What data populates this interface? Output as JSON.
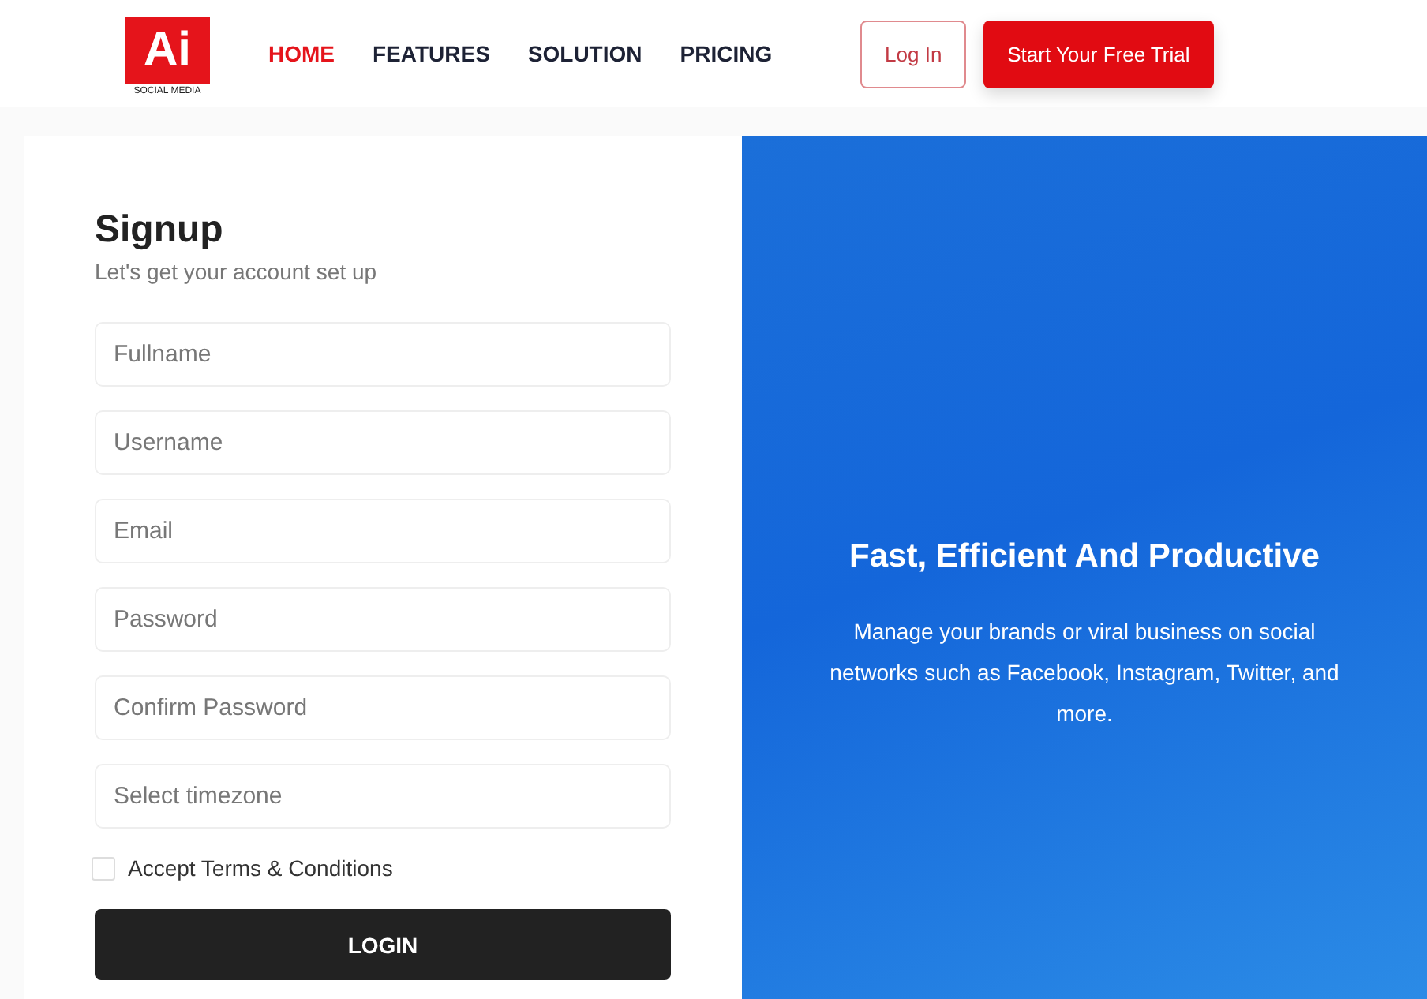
{
  "logo": {
    "mark": "Ai",
    "caption": "SOCIAL MEDIA"
  },
  "nav": [
    {
      "label": "HOME",
      "selected": true
    },
    {
      "label": "FEATURES",
      "selected": false
    },
    {
      "label": "SOLUTION",
      "selected": false
    },
    {
      "label": "PRICING",
      "selected": false
    }
  ],
  "header_buttons": {
    "login": "Log In",
    "trial": "Start Your Free Trial"
  },
  "signup": {
    "title": "Signup",
    "subtitle": "Let's get your account set up",
    "fields": [
      {
        "placeholder": "Fullname"
      },
      {
        "placeholder": "Username"
      },
      {
        "placeholder": "Email"
      },
      {
        "placeholder": "Password"
      },
      {
        "placeholder": "Confirm Password"
      },
      {
        "placeholder": "Select timezone"
      }
    ],
    "terms": {
      "label": "Accept Terms & Conditions",
      "checked": false
    },
    "submit": "LOGIN"
  },
  "hero": {
    "title": "Fast, Efficient And Productive",
    "text": "Manage your brands or viral business on social networks such as Facebook, Instagram, Twitter, and more."
  }
}
